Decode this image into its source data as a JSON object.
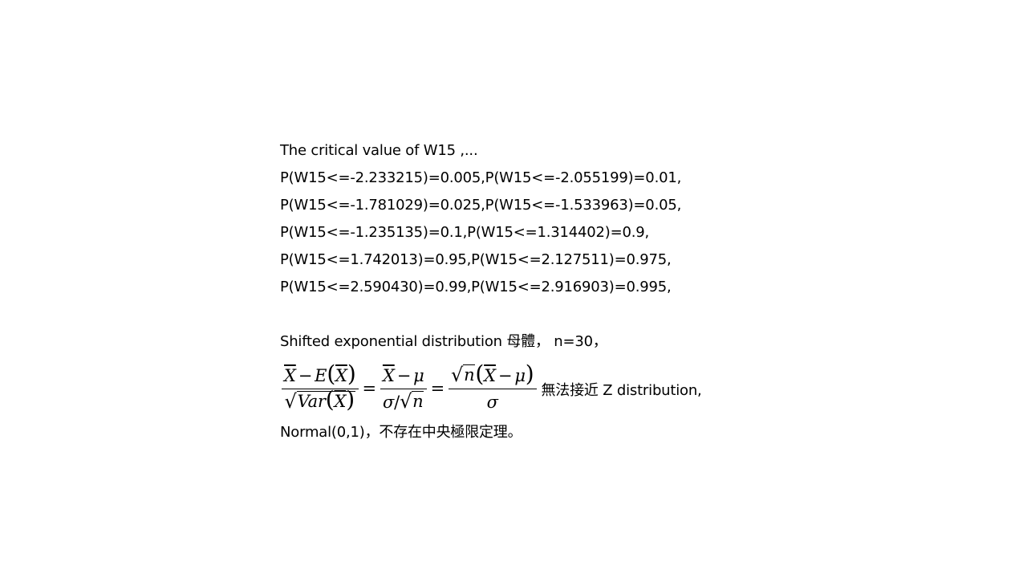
{
  "title_line": "The critical value of W15 ,...",
  "prob_lines": [
    "P(W15<=-2.233215)=0.005,P(W15<=-2.055199)=0.01,",
    "P(W15<=-1.781029)=0.025,P(W15<=-1.533963)=0.05,",
    "P(W15<=-1.235135)=0.1,P(W15<=1.314402)=0.9,",
    "P(W15<=1.742013)=0.95,P(W15<=2.127511)=0.975,",
    "P(W15<=2.590430)=0.99,P(W15<=2.916903)=0.995,"
  ],
  "shifted_line": "Shifted exponential distribution 母體， n=30，",
  "formula": {
    "xbar": "X",
    "minus": "−",
    "expect": "E",
    "var": "Var",
    "sigma": "σ",
    "mu": "μ",
    "n": "n",
    "equals": "=",
    "slash": "/"
  },
  "formula_tail": "無法接近 Z distribution,",
  "last_line": "Normal(0,1)，不存在中央極限定理。"
}
